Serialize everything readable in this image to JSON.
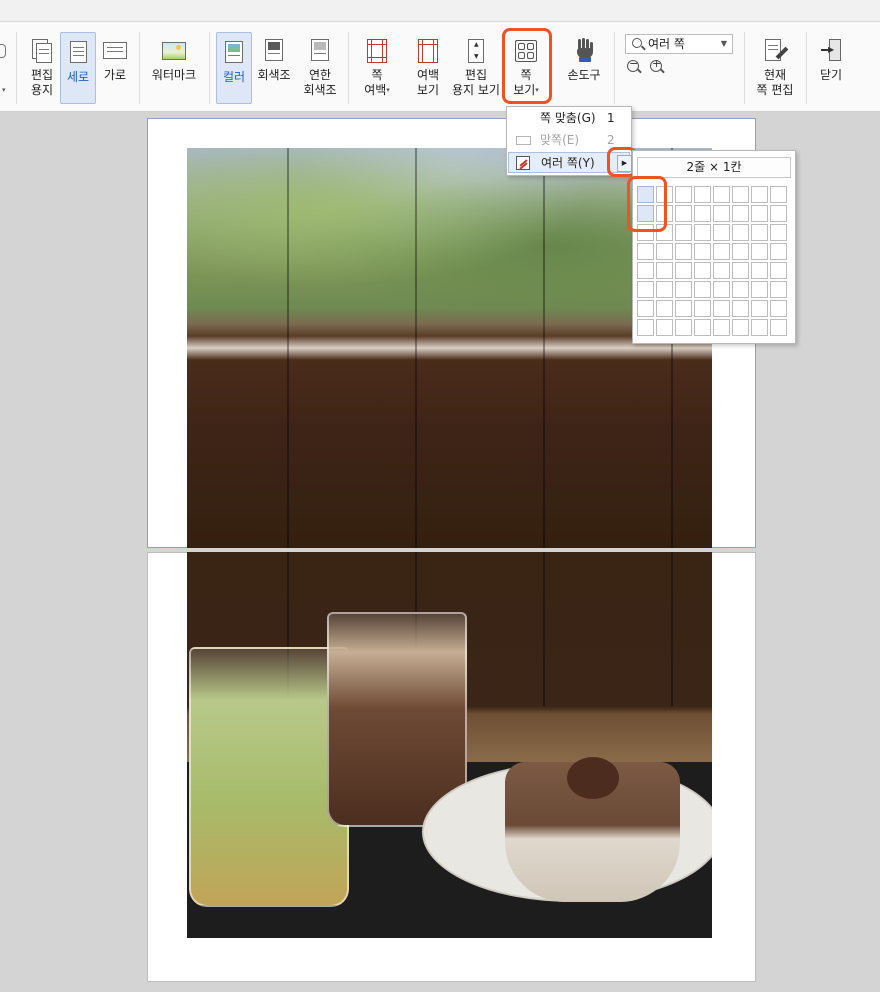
{
  "ribbon": {
    "buttons": [
      {
        "id": "edit-paper",
        "label": "편집\n용지"
      },
      {
        "id": "portrait",
        "label": "세로",
        "active": true
      },
      {
        "id": "landscape",
        "label": "가로"
      },
      {
        "id": "watermark",
        "label": "워터마크"
      },
      {
        "id": "color",
        "label": "컬러",
        "active": true
      },
      {
        "id": "grayscale",
        "label": "회색조"
      },
      {
        "id": "light-grayscale",
        "label": "연한\n회색조"
      },
      {
        "id": "page-margin",
        "label": "쪽\n여백"
      },
      {
        "id": "margin-view",
        "label": "여백\n보기"
      },
      {
        "id": "edit-paper-view",
        "label": "편집\n용지 보기"
      },
      {
        "id": "page-view",
        "label": "쪽\n보기"
      },
      {
        "id": "hand-tool",
        "label": "손도구"
      },
      {
        "id": "edit-current-page",
        "label": "현재\n쪽 편집"
      },
      {
        "id": "close",
        "label": "닫기"
      }
    ],
    "zoom": {
      "value": "여러 쪽"
    }
  },
  "menu": {
    "items": [
      {
        "label": "쪽 맞춤(G)",
        "key": "1",
        "disabled": false
      },
      {
        "label": "맞쪽(E)",
        "key": "2",
        "disabled": true
      },
      {
        "label": "여러 쪽(Y)",
        "key": "",
        "selected": true
      }
    ]
  },
  "grid_panel": {
    "title": "2줄 × 1칸",
    "rows": 8,
    "cols": 8,
    "selected_rows": 2,
    "selected_cols": 1
  },
  "colors": {
    "highlight": "#f0531f",
    "active_bg": "#dde7f6",
    "accent_blue": "#1f5fbf"
  }
}
